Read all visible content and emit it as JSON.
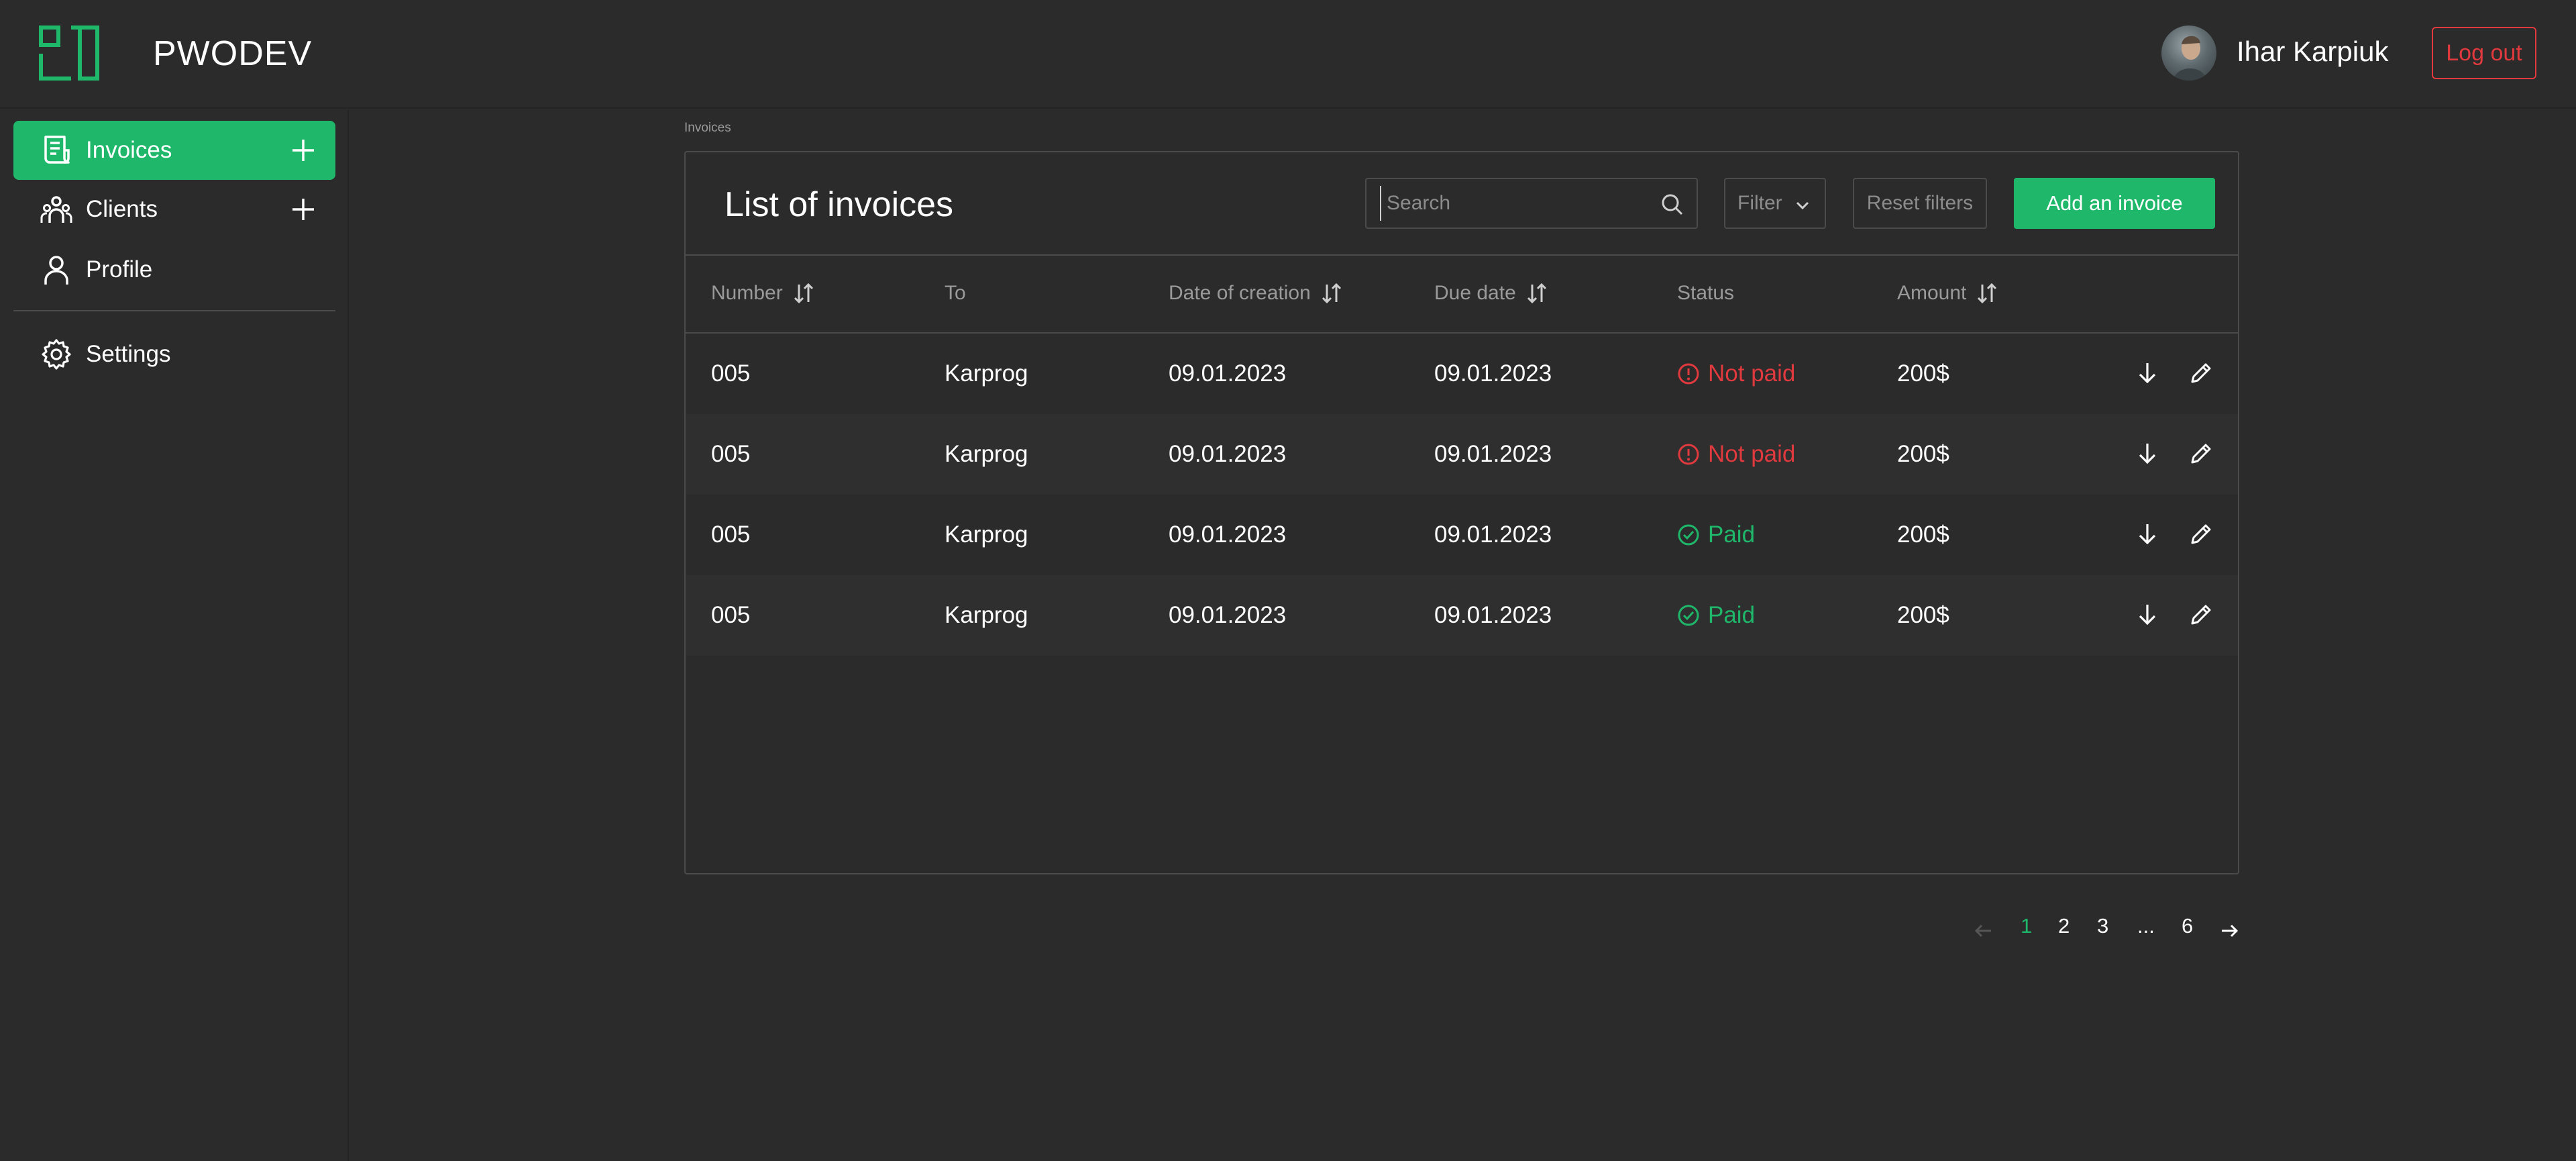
{
  "header": {
    "brand": "PWODEV",
    "user_name": "Ihar Karpiuk",
    "logout_label": "Log out"
  },
  "sidebar": {
    "items": [
      {
        "label": "Invoices",
        "icon": "invoice-icon",
        "active": true,
        "has_add": true
      },
      {
        "label": "Clients",
        "icon": "clients-icon",
        "active": false,
        "has_add": true
      },
      {
        "label": "Profile",
        "icon": "profile-icon",
        "active": false,
        "has_add": false
      },
      {
        "label": "Settings",
        "icon": "gear-icon",
        "active": false,
        "has_add": false
      }
    ]
  },
  "breadcrumb": "Invoices",
  "card": {
    "title": "List of invoices",
    "search_placeholder": "Search",
    "filter_label": "Filter",
    "reset_label": "Reset filters",
    "add_label": "Add an invoice"
  },
  "table": {
    "columns": [
      "Number",
      "To",
      "Date of creation",
      "Due date",
      "Status",
      "Amount"
    ],
    "rows": [
      {
        "number": "005",
        "to": "Karprog",
        "created": "09.01.2023",
        "due": "09.01.2023",
        "status": "Not paid",
        "amount": "200$"
      },
      {
        "number": "005",
        "to": "Karprog",
        "created": "09.01.2023",
        "due": "09.01.2023",
        "status": "Not paid",
        "amount": "200$"
      },
      {
        "number": "005",
        "to": "Karprog",
        "created": "09.01.2023",
        "due": "09.01.2023",
        "status": "Paid",
        "amount": "200$"
      },
      {
        "number": "005",
        "to": "Karprog",
        "created": "09.01.2023",
        "due": "09.01.2023",
        "status": "Paid",
        "amount": "200$"
      }
    ]
  },
  "pagination": {
    "pages": [
      "1",
      "2",
      "3",
      "...",
      "6"
    ],
    "current": "1"
  },
  "colors": {
    "accent": "#1fb86b",
    "danger": "#e0393e",
    "background": "#2a2b2a"
  }
}
